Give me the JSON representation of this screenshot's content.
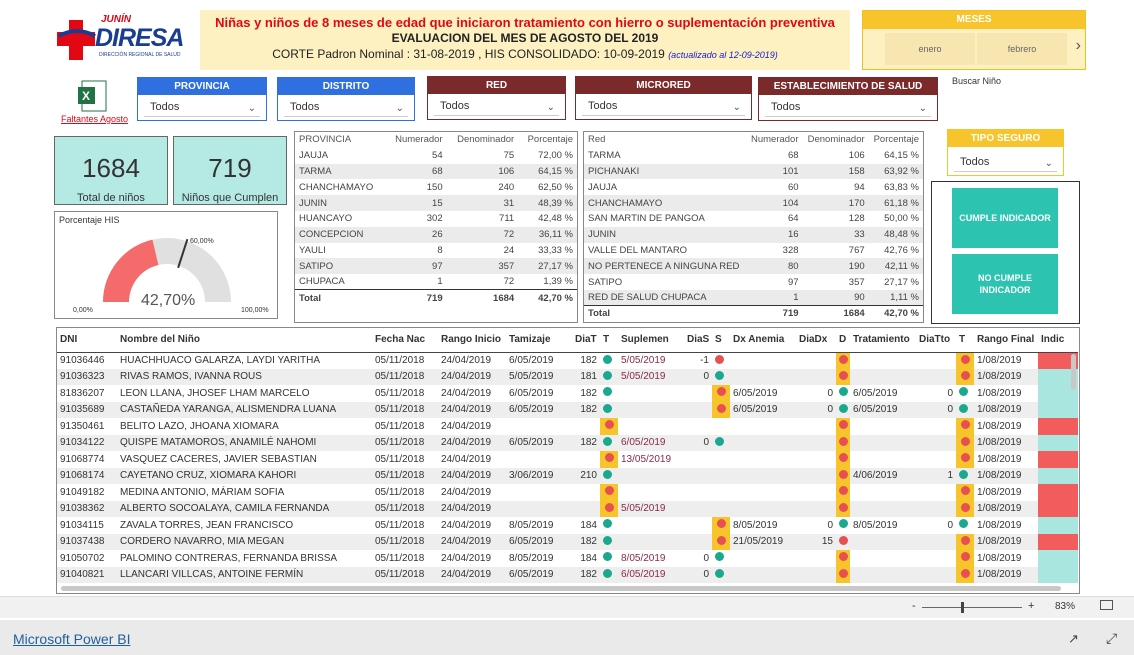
{
  "header": {
    "logo_top": "JUNÍN",
    "logo_main": "DIRESA",
    "logo_sub": "DIRECCIÓN REGIONAL DE SALUD",
    "title1": "Niñas y niños de 8 meses de edad que iniciaron tratamiento con hierro o suplementación preventiva",
    "title2": "EVALUACION DEL MES DE AGOSTO DEL 2019",
    "title3": "CORTE Padron Nominal : 31-08-2019 ,  HIS CONSOLIDADO: 10-09-2019",
    "title3_note": "(actualizado al  12-09-2019)"
  },
  "meses": {
    "label": "MESES",
    "items": [
      "enero",
      "febrero"
    ]
  },
  "faltantes": "Faltantes Agosto",
  "slicers": [
    {
      "label": "PROVINCIA",
      "value": "Todos"
    },
    {
      "label": "DISTRITO",
      "value": "Todos"
    },
    {
      "label": "RED",
      "value": "Todos"
    },
    {
      "label": "MICRORED",
      "value": "Todos"
    },
    {
      "label": "ESTABLECIMIENTO DE SALUD",
      "value": "Todos"
    }
  ],
  "buscar": "Buscar Niño",
  "tipo_seguro": {
    "label": "TIPO SEGURO",
    "value": "Todos"
  },
  "kpis": [
    {
      "value": "1684",
      "label": "Total de niños"
    },
    {
      "value": "719",
      "label": "Niños que Cumplen"
    }
  ],
  "gauge": {
    "title": "Porcentaje HIS",
    "value": "42,70%",
    "min": "0,00%",
    "max": "100,00%",
    "target": "60,00%",
    "value_fraction": 0.427,
    "target_fraction": 0.6
  },
  "prov_table": {
    "headers": [
      "PROVINCIA",
      "Numerador",
      "Denominador",
      "Porcentaje"
    ],
    "rows": [
      [
        "JAUJA",
        "54",
        "75",
        "72,00 %",
        "g"
      ],
      [
        "TARMA",
        "68",
        "106",
        "64,15 %",
        "g"
      ],
      [
        "CHANCHAMAYO",
        "150",
        "240",
        "62,50 %",
        "g"
      ],
      [
        "JUNIN",
        "15",
        "31",
        "48,39 %",
        "r"
      ],
      [
        "HUANCAYO",
        "302",
        "711",
        "42,48 %",
        "r"
      ],
      [
        "CONCEPCION",
        "26",
        "72",
        "36,11 %",
        "r"
      ],
      [
        "YAULI",
        "8",
        "24",
        "33,33 %",
        "r"
      ],
      [
        "SATIPO",
        "97",
        "357",
        "27,17 %",
        "r"
      ],
      [
        "CHUPACA",
        "1",
        "72",
        "1,39 %",
        "r"
      ]
    ],
    "total": [
      "Total",
      "719",
      "1684",
      "42,70 %"
    ]
  },
  "red_table": {
    "headers": [
      "Red",
      "Numerador",
      "Denominador",
      "Porcentaje"
    ],
    "rows": [
      [
        "TARMA",
        "68",
        "106",
        "64,15 %",
        "g"
      ],
      [
        "PICHANAKI",
        "101",
        "158",
        "63,92 %",
        "g"
      ],
      [
        "JAUJA",
        "60",
        "94",
        "63,83 %",
        "g"
      ],
      [
        "CHANCHAMAYO",
        "104",
        "170",
        "61,18 %",
        "g"
      ],
      [
        "SAN MARTIN DE PANGOA",
        "64",
        "128",
        "50,00 %",
        "r"
      ],
      [
        "JUNIN",
        "16",
        "33",
        "48,48 %",
        "r"
      ],
      [
        "VALLE DEL MANTARO",
        "328",
        "767",
        "42,76 %",
        "r"
      ],
      [
        "NO PERTENECE A NINGUNA RED",
        "80",
        "190",
        "42,11 %",
        "r"
      ],
      [
        "SATIPO",
        "97",
        "357",
        "27,17 %",
        "r"
      ],
      [
        "RED DE SALUD CHUPACA",
        "1",
        "90",
        "1,11 %",
        "r"
      ]
    ],
    "total": [
      "Total",
      "719",
      "1684",
      "42,70 %"
    ]
  },
  "indicators": {
    "cumple": "CUMPLE INDICADOR",
    "no_cumple": "NO CUMPLE INDICADOR"
  },
  "main_table": {
    "headers": [
      "DNI",
      "Nombre del Niño",
      "Fecha Nac",
      "Rango Inicio",
      "Tamizaje",
      "DiaT",
      "T",
      "Suplemen",
      "DiaS",
      "S",
      "Dx Anemia",
      "DiaDx",
      "D",
      "Tratamiento",
      "DiaTto",
      "T",
      "Rango Final",
      "Indic"
    ],
    "rows": [
      [
        "91036446",
        "HUACHHUACO GALARZA, LAYDI YARITHA",
        "05/11/2018",
        "24/04/2019",
        "6/05/2019",
        "182",
        "g",
        "5/05/2019",
        "-1",
        "r",
        "",
        "",
        "y",
        "",
        "",
        "y",
        "1/08/2019",
        "r"
      ],
      [
        "91036323",
        "RIVAS RAMOS, IVANNA ROUS",
        "05/11/2018",
        "24/04/2019",
        "5/05/2019",
        "181",
        "g",
        "5/05/2019",
        "0",
        "g",
        "",
        "",
        "y",
        "",
        "",
        "y",
        "1/08/2019",
        "g"
      ],
      [
        "81836207",
        "LEON LLANA, JHOSEF LHAM MARCELO",
        "05/11/2018",
        "24/04/2019",
        "6/05/2019",
        "182",
        "g",
        "",
        "",
        "y",
        "6/05/2019",
        "0",
        "g",
        "6/05/2019",
        "0",
        "g",
        "1/08/2019",
        "g"
      ],
      [
        "91035689",
        "CASTAÑEDA YARANGA, ALISMENDRA LUANA",
        "05/11/2018",
        "24/04/2019",
        "6/05/2019",
        "182",
        "g",
        "",
        "",
        "y",
        "6/05/2019",
        "0",
        "g",
        "6/05/2019",
        "0",
        "g",
        "1/08/2019",
        "g"
      ],
      [
        "91350461",
        "BELITO LAZO, JHOANA XIOMARA",
        "05/11/2018",
        "24/04/2019",
        "",
        "",
        "y",
        "",
        "",
        "",
        "",
        "",
        "y",
        "",
        "",
        "y",
        "1/08/2019",
        "r"
      ],
      [
        "91034122",
        "QUISPE MATAMOROS, ANAMILÉ NAHOMI",
        "05/11/2018",
        "24/04/2019",
        "6/05/2019",
        "182",
        "g",
        "6/05/2019",
        "0",
        "g",
        "",
        "",
        "y",
        "",
        "",
        "y",
        "1/08/2019",
        "g"
      ],
      [
        "91068774",
        "VASQUEZ CACERES, JAVIER SEBASTIAN",
        "05/11/2018",
        "24/04/2019",
        "",
        "",
        "y",
        "13/05/2019",
        "",
        "",
        "",
        "",
        "y",
        "",
        "",
        "y",
        "1/08/2019",
        "r"
      ],
      [
        "91068174",
        "CAYETANO CRUZ, XIOMARA KAHORI",
        "05/11/2018",
        "24/04/2019",
        "3/06/2019",
        "210",
        "g",
        "",
        "",
        "",
        "",
        "",
        "y",
        "4/06/2019",
        "1",
        "g",
        "1/08/2019",
        "g"
      ],
      [
        "91049182",
        "MEDINA ANTONIO, MÁRIAM SOFIA",
        "05/11/2018",
        "24/04/2019",
        "",
        "",
        "y",
        "",
        "",
        "",
        "",
        "",
        "y",
        "",
        "",
        "y",
        "1/08/2019",
        "r"
      ],
      [
        "91038362",
        "ALBERTO SOCOALAYA, CAMILA FERNANDA",
        "05/11/2018",
        "24/04/2019",
        "",
        "",
        "y",
        "5/05/2019",
        "",
        "",
        "",
        "",
        "y",
        "",
        "",
        "y",
        "1/08/2019",
        "r"
      ],
      [
        "91034115",
        "ZAVALA TORRES, JEAN FRANCISCO",
        "05/11/2018",
        "24/04/2019",
        "8/05/2019",
        "184",
        "g",
        "",
        "",
        "y",
        "8/05/2019",
        "0",
        "g",
        "8/05/2019",
        "0",
        "g",
        "1/08/2019",
        "g"
      ],
      [
        "91037438",
        "CORDERO NAVARRO, MIA MEGAN",
        "05/11/2018",
        "24/04/2019",
        "6/05/2019",
        "182",
        "g",
        "",
        "",
        "y",
        "21/05/2019",
        "15",
        "r",
        "",
        "",
        "y",
        "1/08/2019",
        "r"
      ],
      [
        "91050702",
        "PALOMINO CONTRERAS, FERNANDA BRISSA",
        "05/11/2018",
        "24/04/2019",
        "8/05/2019",
        "184",
        "g",
        "8/05/2019",
        "0",
        "g",
        "",
        "",
        "y",
        "",
        "",
        "y",
        "1/08/2019",
        "g"
      ],
      [
        "91040821",
        "LLANCARI VILLCAS, ANTOINE FERMÍN",
        "05/11/2018",
        "24/04/2019",
        "6/05/2019",
        "182",
        "g",
        "6/05/2019",
        "0",
        "g",
        "",
        "",
        "y",
        "",
        "",
        "y",
        "1/08/2019",
        "g"
      ]
    ]
  },
  "zoom": {
    "minus": "-",
    "plus": "+",
    "level": "83%",
    "fraction": 0.83
  },
  "footer": {
    "brand": "Microsoft Power BI"
  }
}
